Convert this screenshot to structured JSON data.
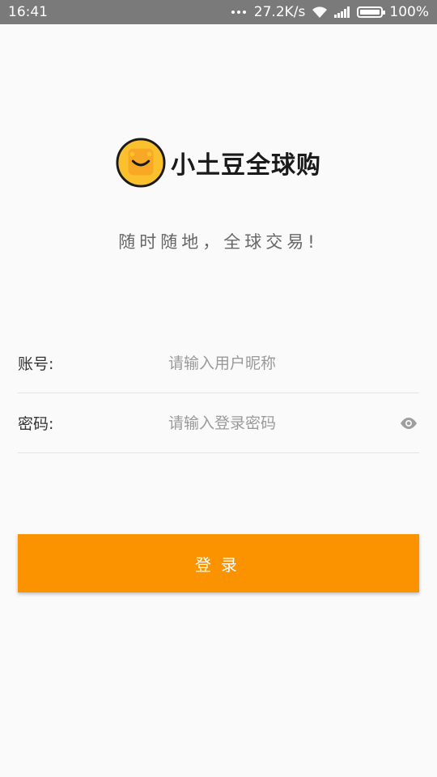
{
  "status_bar": {
    "time": "16:41",
    "net_speed": "27.2K/s",
    "battery": "100%"
  },
  "brand": {
    "name": "小土豆全球购",
    "slogan": "随时随地，全球交易!",
    "accent_color": "#fb9300",
    "logo_color": "#fbc02d"
  },
  "form": {
    "account_label": "账号:",
    "account_placeholder": "请输入用户昵称",
    "account_value": "",
    "password_label": "密码:",
    "password_placeholder": "请输入登录密码",
    "password_value": "",
    "password_toggle_icon": "eye-icon"
  },
  "login_button": {
    "label": "登录"
  }
}
